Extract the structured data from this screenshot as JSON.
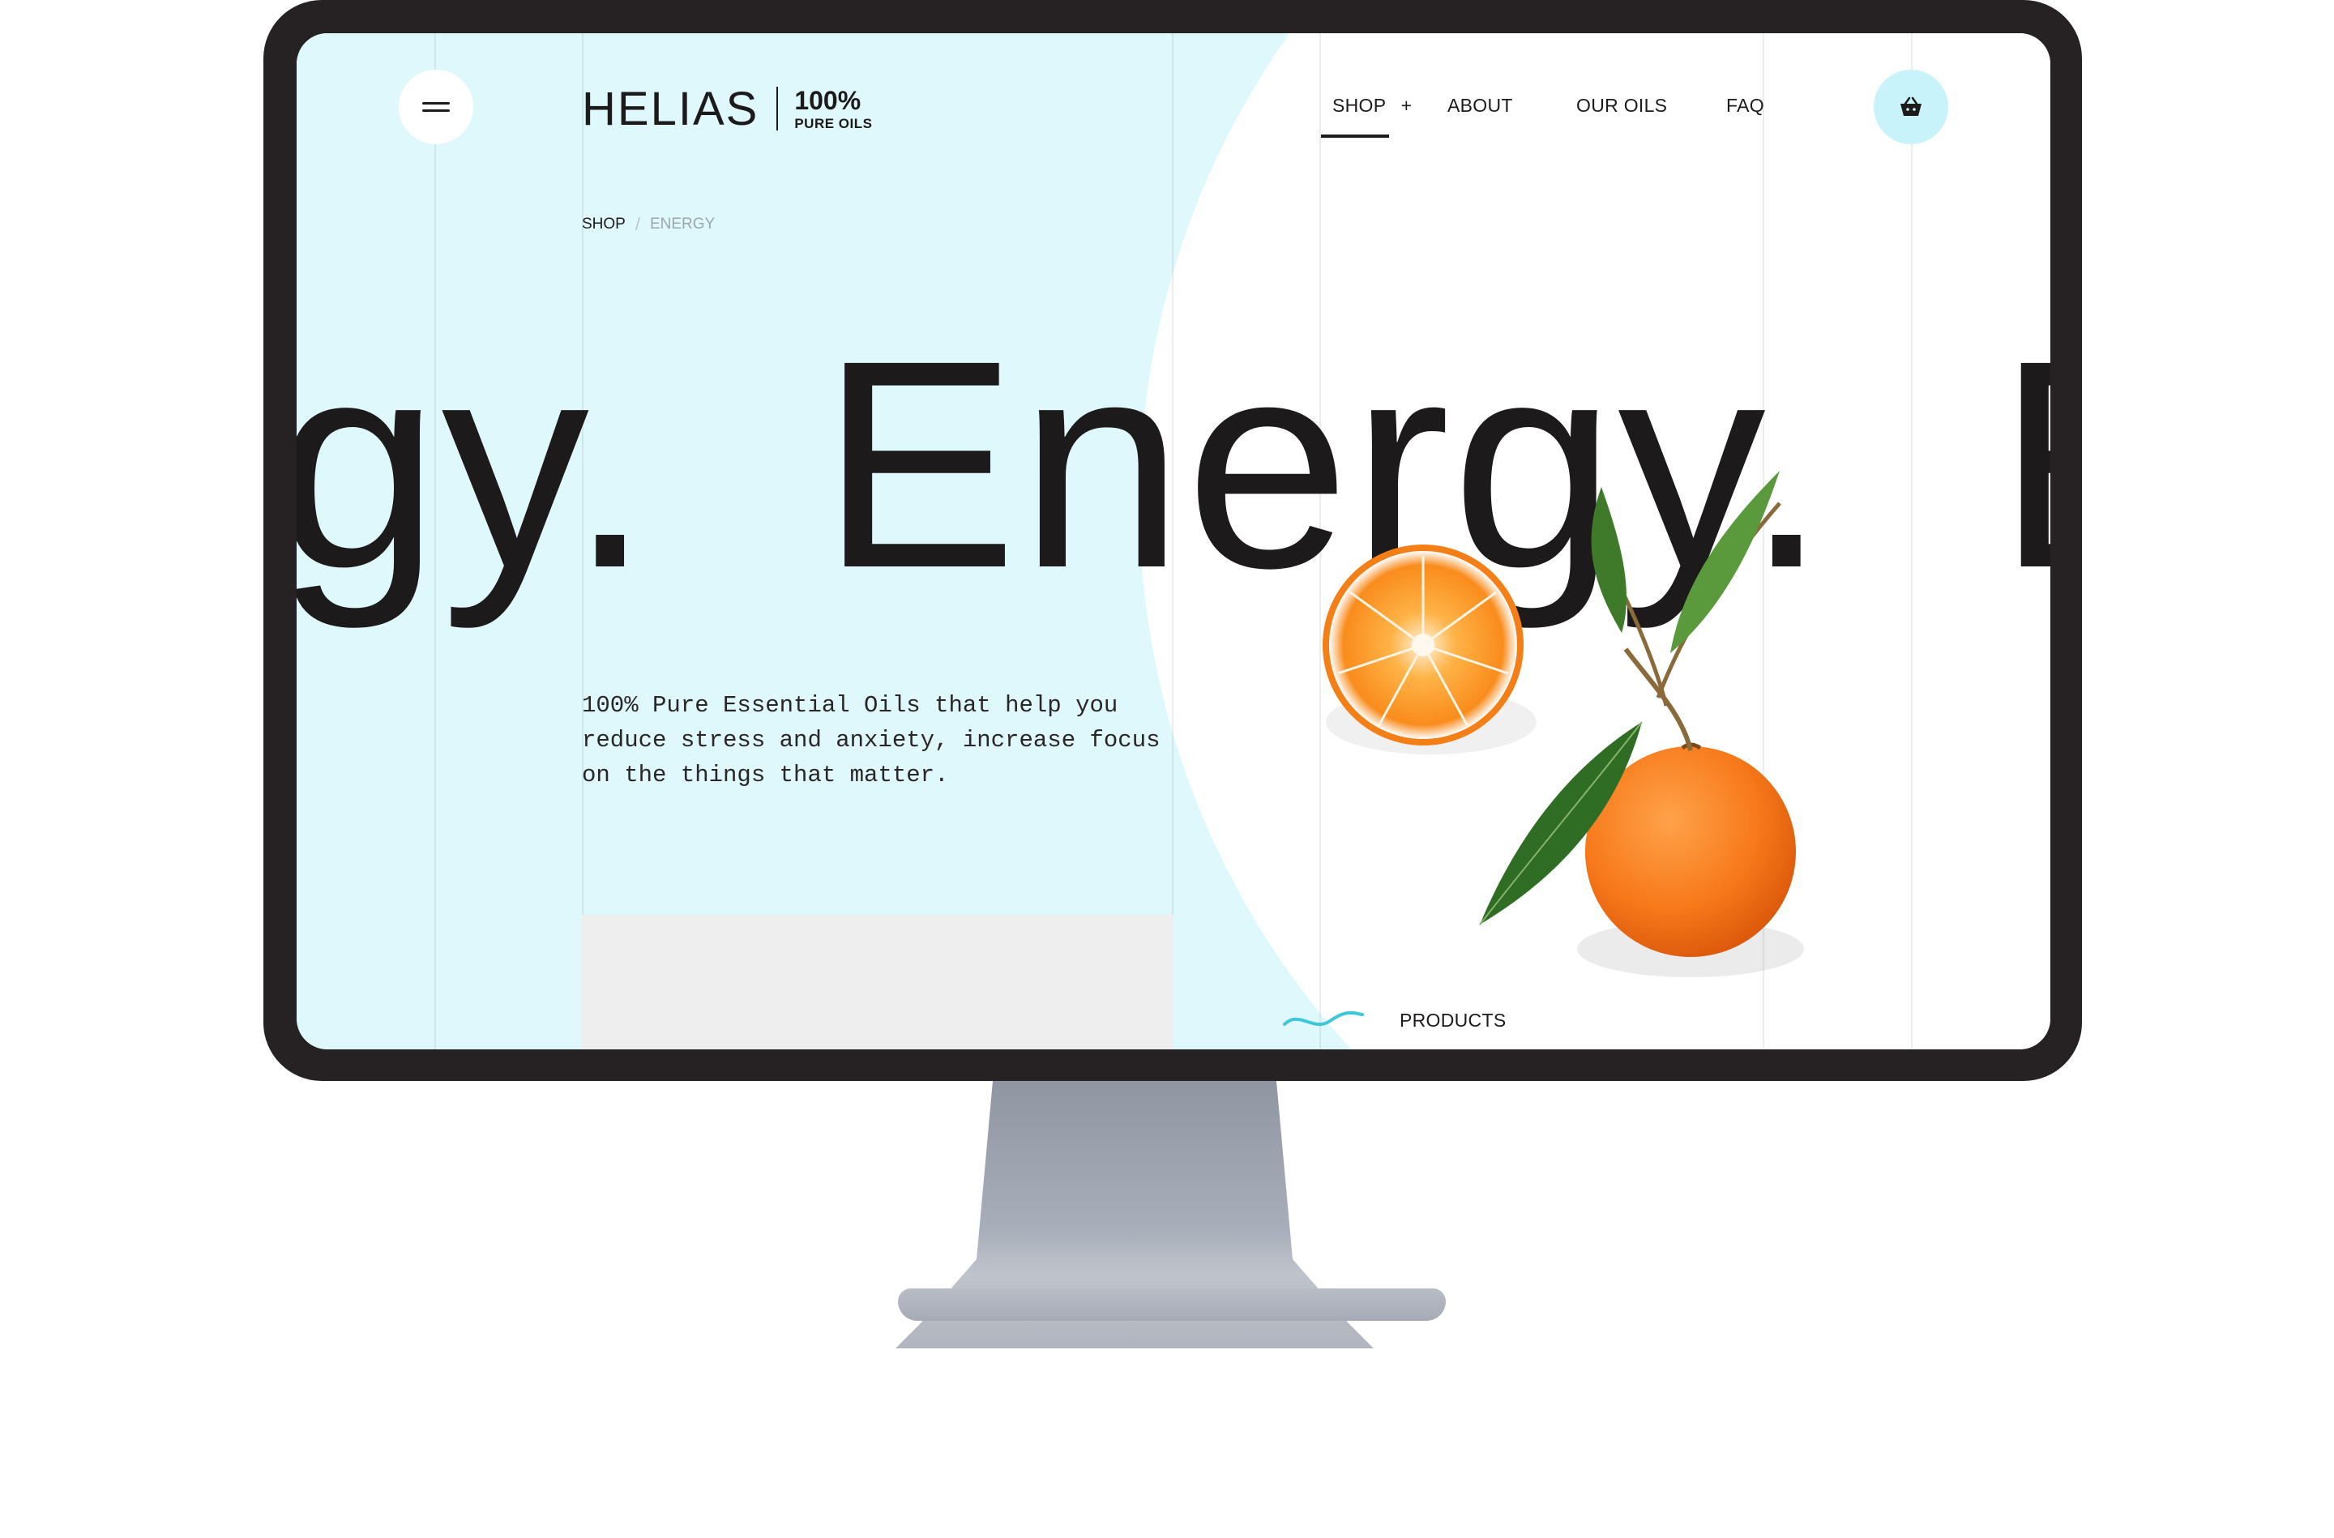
{
  "brand": {
    "name": "HELIAS",
    "badge_percent": "100%",
    "badge_sub": "PURE OILS"
  },
  "nav": {
    "items": [
      {
        "label": "SHOP",
        "suffix": "+"
      },
      {
        "label": "ABOUT"
      },
      {
        "label": "OUR OILS"
      },
      {
        "label": "FAQ"
      }
    ],
    "active": "SHOP"
  },
  "icons": {
    "menu": "hamburger-icon",
    "cart": "basket-icon",
    "products": "wave-icon"
  },
  "breadcrumb": {
    "items": [
      "SHOP",
      "ENERGY"
    ],
    "separator": "/"
  },
  "hero": {
    "marquee_text": "rgy.  Energy.  E"
  },
  "intro": {
    "text": "100% Pure Essential Oils that help you reduce stress and anxiety, increase focus on the things that matter."
  },
  "products_link": {
    "label": "PRODUCTS"
  },
  "colors": {
    "background_light_blue": "#dff8fc",
    "cart_button": "#c9f3fa",
    "accent_wave": "#3ec6d9",
    "text_dark": "#1d1a1b",
    "monitor_frame": "#262223"
  }
}
